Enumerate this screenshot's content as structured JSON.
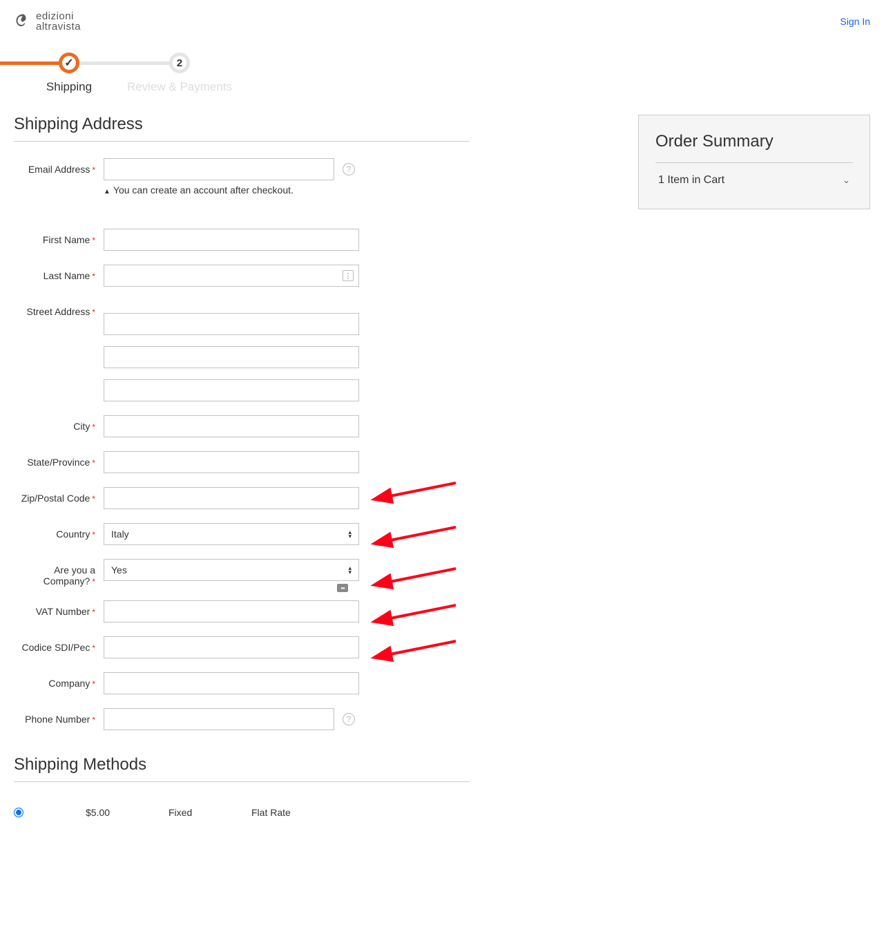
{
  "header": {
    "logo_text_top": "edizioni",
    "logo_text_bottom": "altravista",
    "signin": "Sign In"
  },
  "progress": {
    "step1_label": "Shipping",
    "step2_num": "2",
    "step2_label": "Review & Payments"
  },
  "section": {
    "shipping_address": "Shipping Address",
    "shipping_methods": "Shipping Methods"
  },
  "labels": {
    "email": "Email Address",
    "email_hint": "You can create an account after checkout.",
    "first_name": "First Name",
    "last_name": "Last Name",
    "street": "Street Address",
    "city": "City",
    "state": "State/Province",
    "zip": "Zip/Postal Code",
    "country": "Country",
    "company_q": "Are you a Company?",
    "vat": "VAT Number",
    "sdi": "Codice SDI/Pec",
    "company": "Company",
    "phone": "Phone Number"
  },
  "values": {
    "country": "Italy",
    "company_q": "Yes"
  },
  "summary": {
    "title": "Order Summary",
    "cart": "1 Item in Cart"
  },
  "method": {
    "price": "$5.00",
    "type": "Fixed",
    "rate": "Flat Rate"
  }
}
